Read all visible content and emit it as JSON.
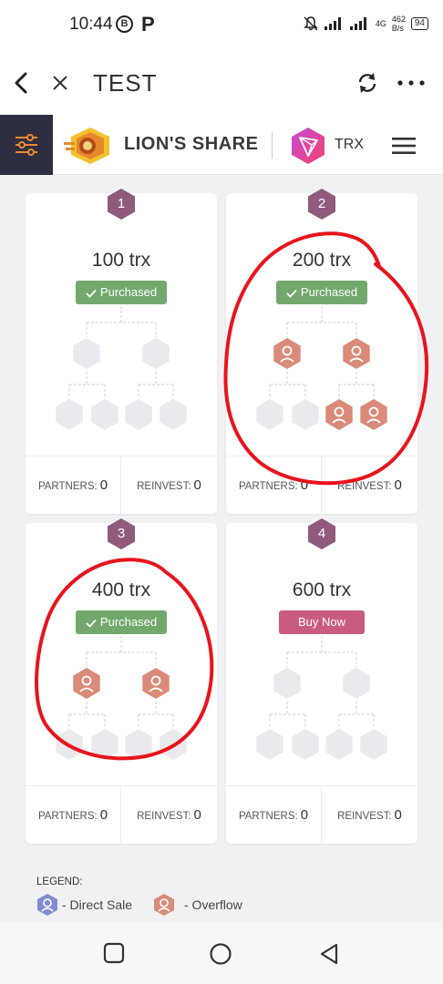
{
  "status_bar": {
    "time": "10:44",
    "notification_badge": "B",
    "app_icon": "P",
    "network_speed_value": "462",
    "network_speed_unit": "B/s",
    "network_type": "4G",
    "battery": "94"
  },
  "app_header": {
    "title": "TEST"
  },
  "site_nav": {
    "brand": "LION'S SHARE",
    "currency": "TRX"
  },
  "cards": [
    {
      "number": "1",
      "amount": "100 trx",
      "status": "Purchased",
      "partners_label": "PARTNERS:",
      "partners": "0",
      "reinvest_label": "REINVEST:",
      "reinvest": "0",
      "level1": [
        "empty",
        "empty"
      ],
      "level2": [
        "empty",
        "empty",
        "empty",
        "empty"
      ]
    },
    {
      "number": "2",
      "amount": "200 trx",
      "status": "Purchased",
      "partners_label": "PARTNERS:",
      "partners": "0",
      "reinvest_label": "REINVEST:",
      "reinvest": "0",
      "level1": [
        "overflow",
        "overflow"
      ],
      "level2": [
        "empty",
        "empty",
        "overflow",
        "overflow"
      ]
    },
    {
      "number": "3",
      "amount": "400 trx",
      "status": "Purchased",
      "partners_label": "PARTNERS:",
      "partners": "0",
      "reinvest_label": "REINVEST:",
      "reinvest": "0",
      "level1": [
        "overflow",
        "overflow"
      ],
      "level2": [
        "empty",
        "empty",
        "empty",
        "empty"
      ]
    },
    {
      "number": "4",
      "amount": "600 trx",
      "status": "Buy Now",
      "partners_label": "PARTNERS:",
      "partners": "0",
      "reinvest_label": "REINVEST:",
      "reinvest": "0",
      "level1": [
        "empty",
        "empty"
      ],
      "level2": [
        "empty",
        "empty",
        "empty",
        "empty"
      ]
    }
  ],
  "legend": {
    "label": "LEGEND:",
    "items": [
      {
        "text": "- Direct Sale",
        "color": "#7f8ed1"
      },
      {
        "text": "- Overflow",
        "color": "#d98a78"
      }
    ]
  },
  "colors": {
    "purchased": "#72a86c",
    "buy_now": "#c95b80",
    "badge": "#8f5a7c",
    "overflow": "#d98a78",
    "empty_slot": "#e9e9ee",
    "annotation": "#e8141c"
  },
  "icons": {
    "back": "chevron-left",
    "close": "x",
    "refresh": "refresh-arrows",
    "more": "three-dots",
    "filter": "sliders",
    "menu": "hamburger",
    "check": "check",
    "nav_recents": "square",
    "nav_home": "circle",
    "nav_back": "triangle"
  }
}
